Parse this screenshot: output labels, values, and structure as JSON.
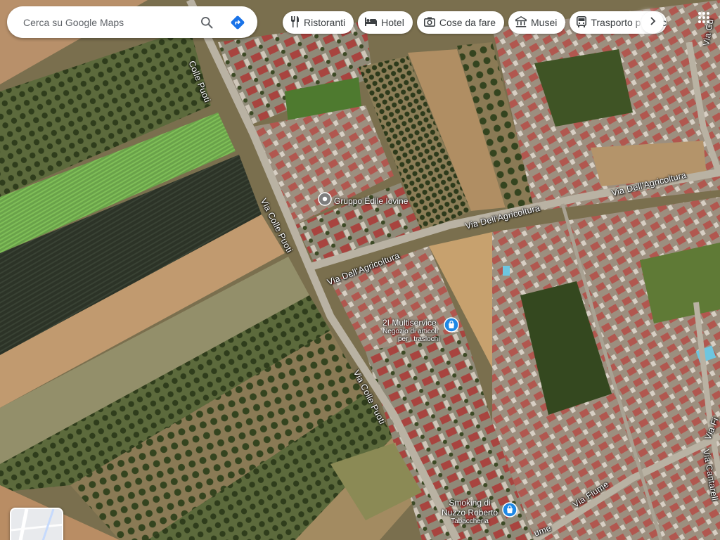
{
  "search": {
    "placeholder": "Cerca su Google Maps"
  },
  "chips": [
    {
      "label": "Ristoranti",
      "icon": "fork-knife-icon"
    },
    {
      "label": "Hotel",
      "icon": "bed-icon"
    },
    {
      "label": "Cose da fare",
      "icon": "camera-icon"
    },
    {
      "label": "Musei",
      "icon": "museum-icon"
    },
    {
      "label": "Trasporto pubblico",
      "icon": "bus-icon"
    }
  ],
  "streets": {
    "colle_puoti_1": "Colle Puoti",
    "colle_puoti_2": "Via Colle Puoti",
    "colle_puoti_3": "Via Colle Puoti",
    "agricoltura_1": "Via Dell'Agricoltura",
    "agricoltura_2": "Via Dell'Agricoltura",
    "agricoltura_3": "Via Dell'Agricoltura",
    "fiume_1": "Via Fiume",
    "fiume_2": "Via Fi",
    "fiume_3": "ume",
    "cantarella": "Via Cantarell",
    "cu": "Via Cu"
  },
  "places": {
    "gruppo_edile": {
      "name": "Gruppo Edile Iovine",
      "icon": "place-pin-icon"
    },
    "multiservice": {
      "name": "2I Multiservice",
      "category": "Negozio di articoli per i traslochi",
      "category_line1": "Negozio di articoli",
      "category_line2": "per i traslochi",
      "icon": "shopping-bag-icon"
    },
    "smoking": {
      "name_line1": "Smoking di",
      "name_line2": "Nuzzo Roberto",
      "category": "Tabaccheria",
      "icon": "shopping-bag-icon"
    }
  },
  "colors": {
    "accent_blue": "#1a73e8",
    "shop_pin": "#1e88e5",
    "chip_bg": "#ffffff"
  }
}
